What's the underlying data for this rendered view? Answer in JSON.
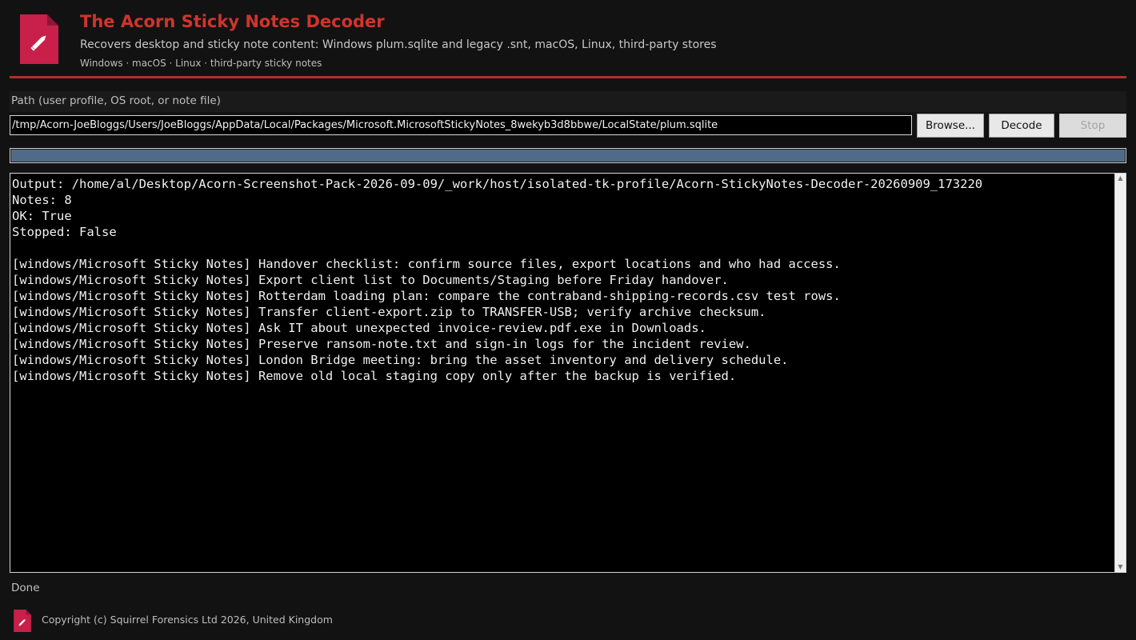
{
  "header": {
    "title": "The Acorn Sticky Notes Decoder",
    "subtitle": "Recovers desktop and sticky note content: Windows plum.sqlite and legacy .snt, macOS, Linux, third-party stores",
    "platforms": "Windows · macOS · Linux · third-party sticky notes",
    "logo_icon": "sticky-note-pencil-icon",
    "accent_color": "#d0342c",
    "logo_color": "#c8204a"
  },
  "path": {
    "label": "Path (user profile, OS root, or note file)",
    "value": "/tmp/Acorn-JoeBloggs/Users/JoeBloggs/AppData/Local/Packages/Microsoft.MicrosoftStickyNotes_8wekyb3d8bbwe/LocalState/plum.sqlite"
  },
  "buttons": {
    "browse": "Browse...",
    "decode": "Decode",
    "stop": "Stop"
  },
  "progress": {
    "value_percent": 100,
    "color": "#4f6b87"
  },
  "output": {
    "lines": [
      "Output: /home/al/Desktop/Acorn-Screenshot-Pack-2026-09-09/_work/host/isolated-tk-profile/Acorn-StickyNotes-Decoder-20260909_173220",
      "Notes: 8",
      "OK: True",
      "Stopped: False",
      "",
      "[windows/Microsoft Sticky Notes] Handover checklist: confirm source files, export locations and who had access.",
      "[windows/Microsoft Sticky Notes] Export client list to Documents/Staging before Friday handover.",
      "[windows/Microsoft Sticky Notes] Rotterdam loading plan: compare the contraband-shipping-records.csv test rows.",
      "[windows/Microsoft Sticky Notes] Transfer client-export.zip to TRANSFER-USB; verify archive checksum.",
      "[windows/Microsoft Sticky Notes] Ask IT about unexpected invoice-review.pdf.exe in Downloads.",
      "[windows/Microsoft Sticky Notes] Preserve ransom-note.txt and sign-in logs for the incident review.",
      "[windows/Microsoft Sticky Notes] London Bridge meeting: bring the asset inventory and delivery schedule.",
      "[windows/Microsoft Sticky Notes] Remove old local staging copy only after the backup is verified."
    ]
  },
  "status": {
    "text": "Done"
  },
  "footer": {
    "copyright": "Copyright (c) Squirrel Forensics Ltd 2026, United Kingdom",
    "logo_icon": "sticky-note-pencil-icon"
  }
}
